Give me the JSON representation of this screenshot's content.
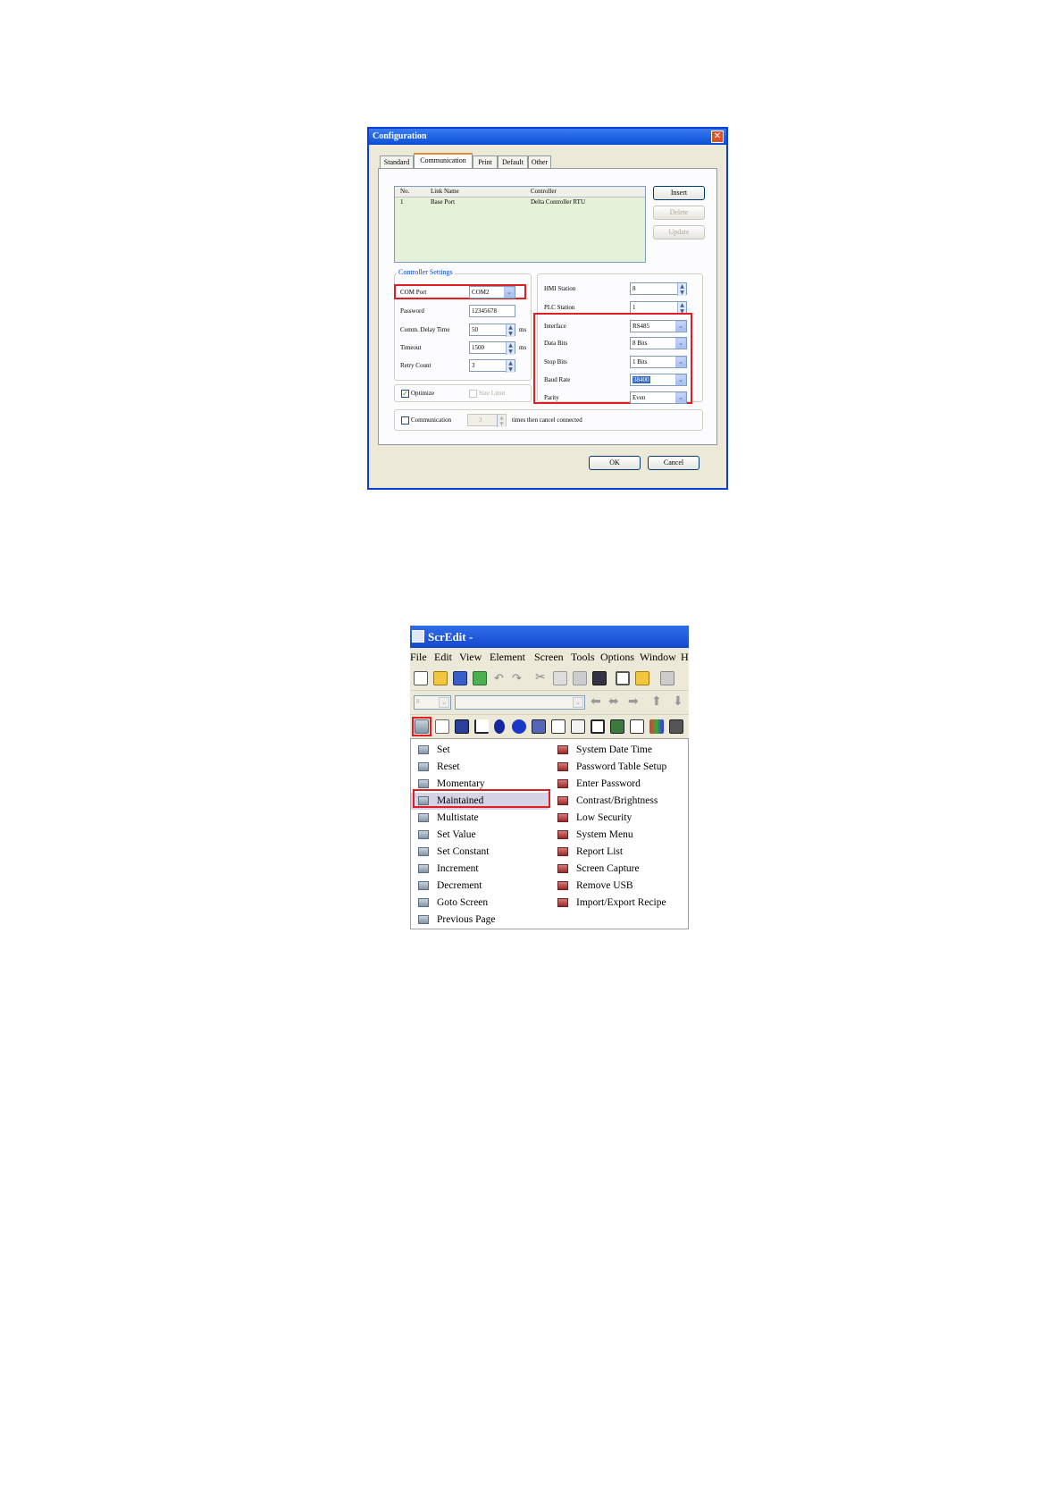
{
  "config": {
    "title": "Configuration",
    "close": "✕",
    "tabs": [
      "Standard",
      "Communication",
      "Print",
      "Default",
      "Other"
    ],
    "list": {
      "headers": [
        "No.",
        "Link Name",
        "Controller"
      ],
      "rows": [
        {
          "no": "1",
          "name": "Base Port",
          "controller": "Delta Controller RTU"
        }
      ]
    },
    "buttons": {
      "insert": "Insert",
      "delete": "Delete",
      "update": "Update",
      "ok": "OK",
      "cancel": "Cancel"
    },
    "controller_settings": {
      "group_label": "Controller Settings",
      "com_port_label": "COM Port",
      "com_port_value": "COM2",
      "password_label": "Password",
      "password_value": "12345678",
      "delay_label": "Comm. Delay Time",
      "delay_value": "50",
      "timeout_label": "Timeout",
      "timeout_value": "1500",
      "unit_ms": "ms",
      "retry_label": "Retry Count",
      "retry_value": "3"
    },
    "right": {
      "hmi_station_label": "HMI Station",
      "hmi_station_value": "8",
      "plc_station_label": "PLC Station",
      "plc_station_value": "1",
      "interface_label": "Interface",
      "interface_value": "RS485",
      "data_bits_label": "Data Bits",
      "data_bits_value": "8 Bits",
      "stop_bits_label": "Stop Bits",
      "stop_bits_value": "1 Bits",
      "baud_rate_label": "Baud Rate",
      "baud_rate_value": "38400",
      "parity_label": "Parity",
      "parity_value": "Even"
    },
    "optimize_label": "Optimize",
    "size_limit_label": "Size Limit",
    "communication_label": "Communication",
    "communication_value": "3",
    "communication_suffix": "times then cancel connected"
  },
  "scredit": {
    "title": "ScrEdit -",
    "menu": [
      "File",
      "Edit",
      "View",
      "Element",
      "Screen",
      "Tools",
      "Options",
      "Window",
      "H"
    ],
    "combo_value": "8",
    "left_items": [
      "Set",
      "Reset",
      "Momentary",
      "Maintained",
      "Multistate",
      "Set Value",
      "Set Constant",
      "Increment",
      "Decrement",
      "Goto Screen",
      "Previous Page"
    ],
    "right_items": [
      "System Date Time",
      "Password Table Setup",
      "Enter Password",
      "Contrast/Brightness",
      "Low Security",
      "System Menu",
      "Report List",
      "Screen Capture",
      "Remove USB",
      "Import/Export Recipe"
    ]
  }
}
